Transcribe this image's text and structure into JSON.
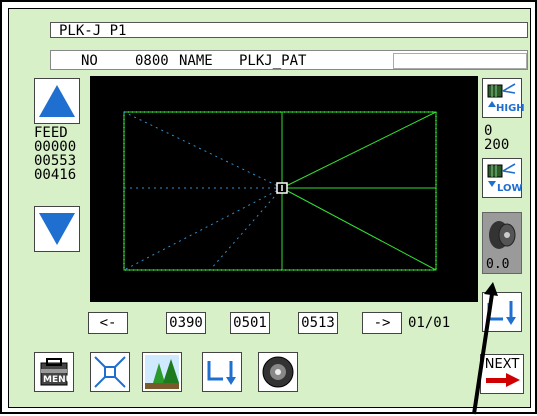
{
  "title": "PLK-J P1",
  "info": {
    "no_label": "NO",
    "no_value": "0800",
    "name_label": "NAME",
    "name_value": "PLKJ_PAT"
  },
  "feed": {
    "label": "FEED",
    "values": [
      "00000",
      "00553",
      "00416"
    ]
  },
  "speed": {
    "high_label": "HIGH",
    "low_label": "LOW",
    "value_top": "0",
    "value_bottom": "200"
  },
  "thread_tension_value": "0.0",
  "navigation": {
    "prev_label": "<-",
    "next_label": "->",
    "fields": [
      "0390",
      "0501",
      "0513"
    ],
    "page": "01/01"
  },
  "toolbar": {
    "menu_label": "MENU",
    "next_label": "NEXT"
  },
  "colors": {
    "panel_bg": "#d8f0c8",
    "accent_blue": "#1f6fd0",
    "stitch_green": "#33dd33",
    "jump_blue": "#2f8fcf",
    "next_arrow_red": "#d00000"
  },
  "icons": {
    "menu": "toolbox-icon",
    "center": "center-arrows-icon",
    "pattern": "trees-icon",
    "stitch_down": "stitch-down-icon",
    "bobbin": "bobbin-icon",
    "spool": "spool-icon"
  }
}
